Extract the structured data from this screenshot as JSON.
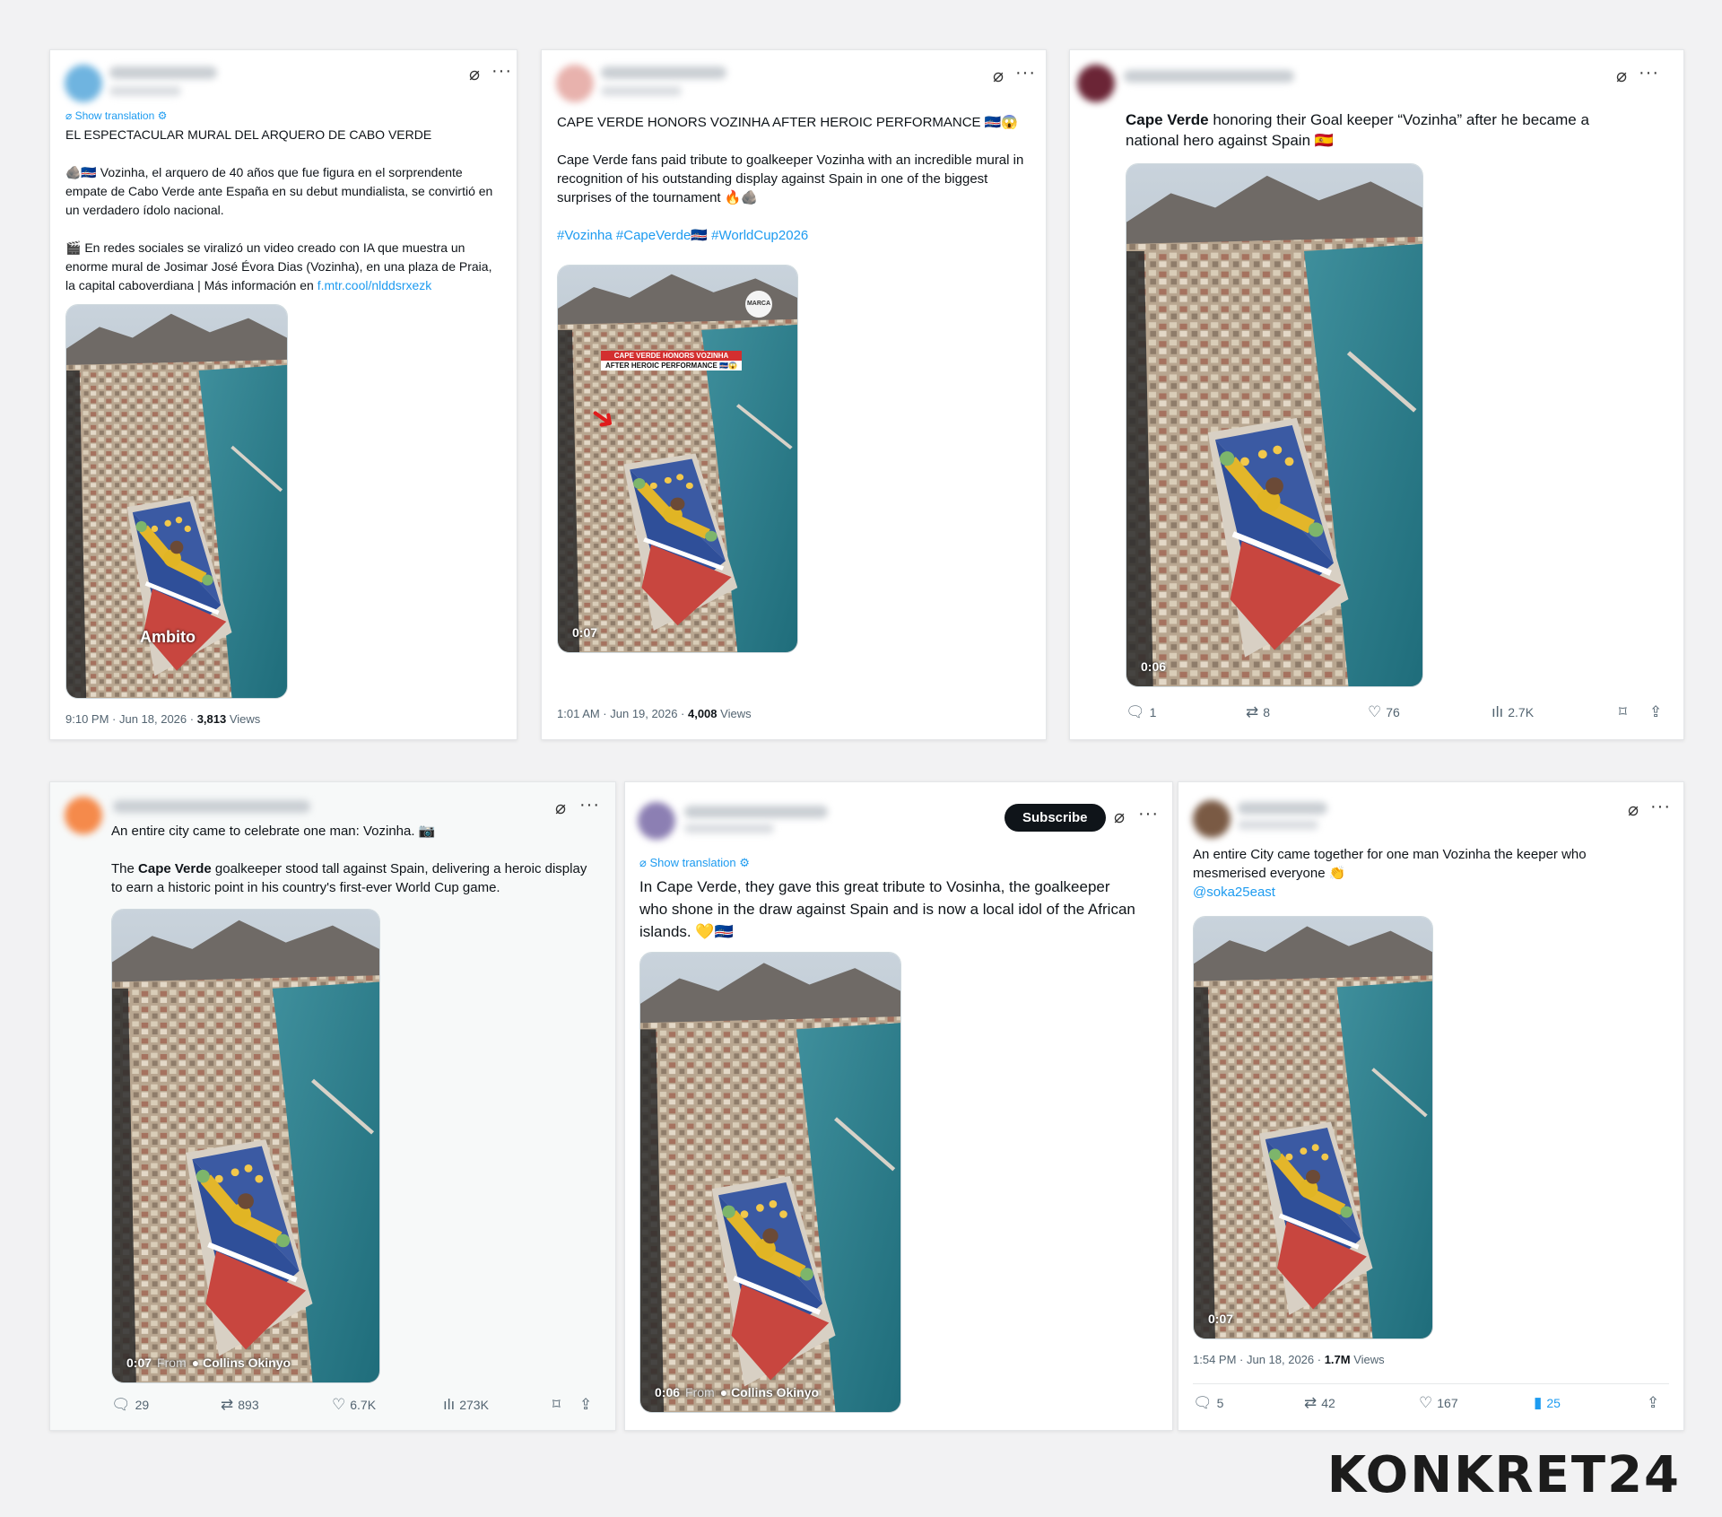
{
  "brand": {
    "logo": "KONKRET24"
  },
  "icons": {
    "grok": "grok-icon",
    "more": "more-icon",
    "reply": "reply-icon",
    "retweet": "retweet-icon",
    "like": "heart-icon",
    "views": "views-icon",
    "bookmark": "bookmark-icon",
    "share": "share-icon"
  },
  "posts": [
    {
      "show_translation": "Show translation",
      "title": "EL ESPECTACULAR MURAL DEL ARQUERO DE CABO VERDE",
      "para1": "🪨🇨🇻 Vozinha, el arquero de 40 años que fue figura en el sorprendente empate de Cabo Verde ante España en su debut mundialista, se convirtió en un verdadero ídolo nacional.",
      "para2": "🎬 En redes sociales se viralizó un video creado con IA que muestra un enorme mural de Josimar José Évora Dias (Vozinha), en una plaza de Praia, la capital caboverdiana | Más información en ",
      "link": "f.mtr.cool/nlddsrxezk",
      "watermark": "Ambito",
      "meta_time": "9:10 PM · Jun 18, 2026 · ",
      "views": "3,813",
      "views_label": " Views"
    },
    {
      "title": "CAPE VERDE HONORS VOZINHA AFTER HEROIC PERFORMANCE 🇨🇻😱",
      "body": "Cape Verde fans paid tribute to goalkeeper Vozinha with an incredible mural in recognition of his outstanding display against Spain in one of the biggest surprises of the tournament 🔥🪨",
      "hashtags": "#Vozinha #CapeVerde🇨🇻 #WorldCup2026",
      "overlay_line1": "CAPE VERDE HONORS VOZINHA",
      "overlay_line2": "AFTER HEROIC PERFORMANCE 🇨🇻😱",
      "badge": "MARCA",
      "duration": "0:07",
      "meta_time": "1:01 AM · Jun 19, 2026 · ",
      "views": "4,008",
      "views_label": " Views"
    },
    {
      "text_bold": "Cape Verde",
      "text_rest": " honoring their Goal keeper “Vozinha” after he became a national hero against Spain 🇪🇸",
      "duration": "0:06",
      "replies": "1",
      "reposts": "8",
      "likes": "76",
      "views": "2.7K"
    },
    {
      "line1": "An entire city came to celebrate one man: Vozinha. 📷",
      "line2_pre": "The ",
      "line2_bold": "Cape Verde",
      "line2_rest": " goalkeeper stood tall against Spain, delivering a heroic display to earn a historic point in his country's first-ever World Cup game.",
      "duration": "0:07",
      "from_label": "From",
      "from_name": "Collins Okinyo",
      "replies": "29",
      "reposts": "893",
      "likes": "6.7K",
      "views": "273K"
    },
    {
      "subscribe": "Subscribe",
      "show_translation": "Show translation",
      "body": "In Cape Verde, they gave this great tribute to Vosinha, the goalkeeper who shone in the draw against Spain and is now a local idol of the African islands. 💛🇨🇻",
      "duration": "0:06",
      "from_label": "From",
      "from_name": "Collins Okinyo"
    },
    {
      "body": "An entire City came together for one man Vozinha the keeper who mesmerised everyone 👏",
      "mention": "@soka25east",
      "duration": "0:07",
      "meta_time": "1:54 PM · Jun 18, 2026 · ",
      "views": "1.7M",
      "views_label": " Views",
      "replies": "5",
      "reposts": "42",
      "likes": "167",
      "bookmarks": "25"
    }
  ]
}
